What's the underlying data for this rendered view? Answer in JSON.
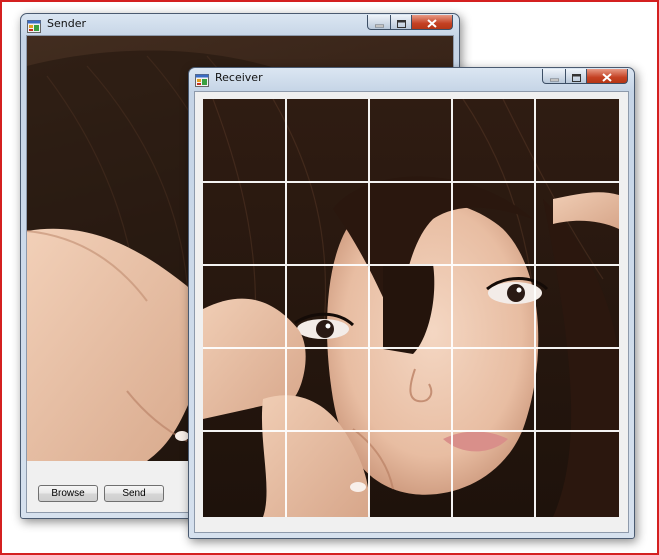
{
  "sender": {
    "title": "Sender",
    "browse_label": "Browse",
    "send_label": "Send"
  },
  "receiver": {
    "title": "Receiver",
    "grid": {
      "rows": 5,
      "cols": 5
    }
  },
  "icons": {
    "app": "app-form-icon",
    "minimize": "minimize-icon",
    "maximize": "maximize-icon",
    "close": "close-icon"
  },
  "colors": {
    "frame_accent": "#d42020",
    "close_button": "#c44123"
  }
}
